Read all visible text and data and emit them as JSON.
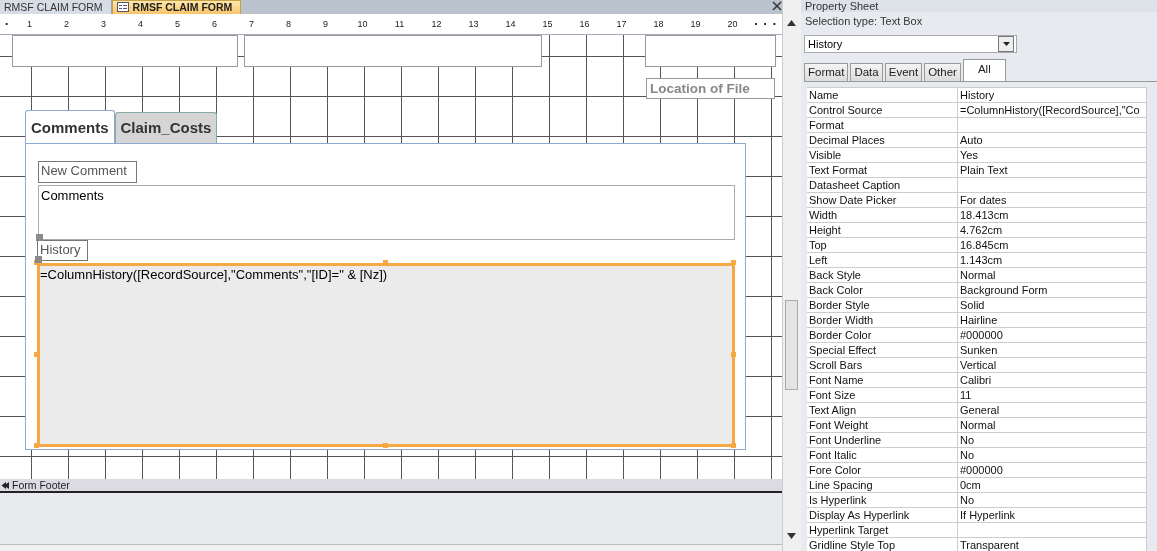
{
  "document_tabs": [
    {
      "label": "RMSF CLAIM FORM",
      "selected": false
    },
    {
      "label": "RMSF CLAIM FORM",
      "selected": true
    }
  ],
  "ruler": {
    "marks": [
      "1",
      "2",
      "3",
      "4",
      "5",
      "6",
      "7",
      "8",
      "9",
      "10",
      "11",
      "12",
      "13",
      "14",
      "15",
      "16",
      "17",
      "18",
      "19",
      "20"
    ]
  },
  "form_design": {
    "location_label": "Location of File",
    "tab_control": {
      "tabs": [
        {
          "label": "Comments",
          "selected": true
        },
        {
          "label": "Claim_Costs",
          "selected": false
        }
      ],
      "controls": [
        {
          "kind": "label",
          "text": "New Comment",
          "selected": false
        },
        {
          "kind": "textbox",
          "text": "Comments",
          "selected": false
        },
        {
          "kind": "label",
          "text": "History",
          "selected": false
        },
        {
          "kind": "textbox",
          "text": "=ColumnHistory([RecordSource],\"Comments\",\"[ID]=\" & [Nz])",
          "selected": true
        }
      ]
    }
  },
  "section_bar": {
    "label": "Form Footer"
  },
  "property_sheet": {
    "title": "Property Sheet",
    "selection_type": "Selection type:  Text Box",
    "object_combo": "History",
    "tabs": [
      {
        "label": "Format",
        "selected": false
      },
      {
        "label": "Data",
        "selected": false
      },
      {
        "label": "Event",
        "selected": false
      },
      {
        "label": "Other",
        "selected": false
      },
      {
        "label": "All",
        "selected": true
      }
    ],
    "properties": [
      {
        "name": "Name",
        "value": "History"
      },
      {
        "name": "Control Source",
        "value": "=ColumnHistory([RecordSource],\"Co"
      },
      {
        "name": "Format"
      },
      {
        "name": "Decimal Places",
        "value": "Auto"
      },
      {
        "name": "Visible",
        "value": "Yes"
      },
      {
        "name": "Text Format",
        "value": "Plain Text"
      },
      {
        "name": "Datasheet Caption"
      },
      {
        "name": "Show Date Picker",
        "value": "For dates"
      },
      {
        "name": "Width",
        "value": "18.413cm"
      },
      {
        "name": "Height",
        "value": "4.762cm"
      },
      {
        "name": "Top",
        "value": "16.845cm"
      },
      {
        "name": "Left",
        "value": "1.143cm"
      },
      {
        "name": "Back Style",
        "value": "Normal"
      },
      {
        "name": "Back Color",
        "value": "Background Form"
      },
      {
        "name": "Border Style",
        "value": "Solid"
      },
      {
        "name": "Border Width",
        "value": "Hairline"
      },
      {
        "name": "Border Color",
        "value": "#000000"
      },
      {
        "name": "Special Effect",
        "value": "Sunken"
      },
      {
        "name": "Scroll Bars",
        "value": "Vertical"
      },
      {
        "name": "Font Name",
        "value": "Calibri"
      },
      {
        "name": "Font Size",
        "value": "11"
      },
      {
        "name": "Text Align",
        "value": "General"
      },
      {
        "name": "Font Weight",
        "value": "Normal"
      },
      {
        "name": "Font Underline",
        "value": "No"
      },
      {
        "name": "Font Italic",
        "value": "No"
      },
      {
        "name": "Fore Color",
        "value": "#000000"
      },
      {
        "name": "Line Spacing",
        "value": "0cm"
      },
      {
        "name": "Is Hyperlink",
        "value": "No"
      },
      {
        "name": "Display As Hyperlink",
        "value": "If Hyperlink"
      },
      {
        "name": "Hyperlink Target"
      },
      {
        "name": "Gridline Style Top",
        "value": "Transparent"
      }
    ]
  }
}
